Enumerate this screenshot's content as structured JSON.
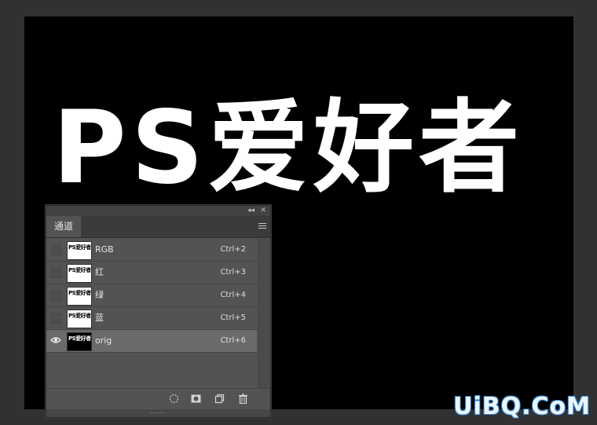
{
  "canvas": {
    "title": "PS爱好者"
  },
  "watermark": "UiBQ.CoM",
  "panel": {
    "tab": "通道",
    "channels": [
      {
        "name": "RGB",
        "shortcut": "Ctrl+2",
        "visible": false,
        "thumb_text": "PS爱好者",
        "selected": false
      },
      {
        "name": "红",
        "shortcut": "Ctrl+3",
        "visible": false,
        "thumb_text": "PS爱好者",
        "selected": false
      },
      {
        "name": "绿",
        "shortcut": "Ctrl+4",
        "visible": false,
        "thumb_text": "PS爱好者",
        "selected": false
      },
      {
        "name": "蓝",
        "shortcut": "Ctrl+5",
        "visible": false,
        "thumb_text": "PS爱好者",
        "selected": false
      },
      {
        "name": "orig",
        "shortcut": "Ctrl+6",
        "visible": true,
        "thumb_text": "PS爱好者",
        "selected": true
      }
    ]
  }
}
